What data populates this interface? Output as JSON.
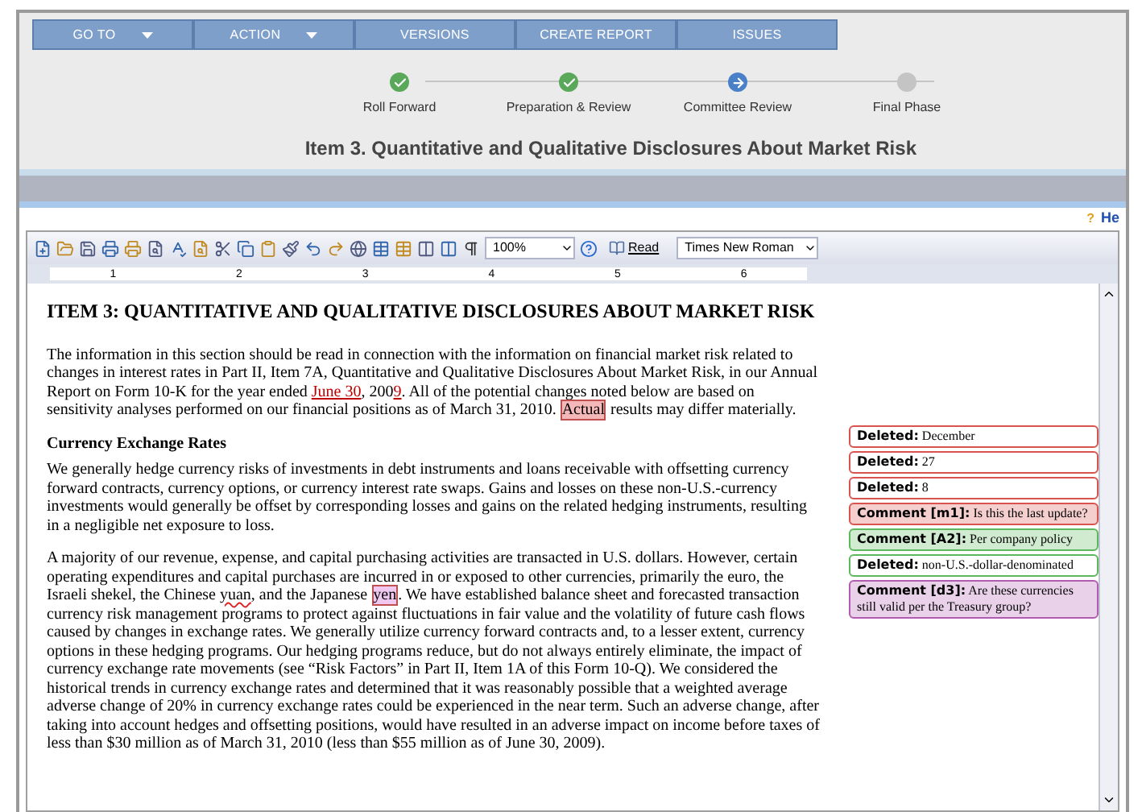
{
  "nav": [
    {
      "label": "GO TO",
      "dropdown": true
    },
    {
      "label": "ACTION",
      "dropdown": true
    },
    {
      "label": "VERSIONS",
      "dropdown": false
    },
    {
      "label": "CREATE REPORT",
      "dropdown": false
    },
    {
      "label": "ISSUES",
      "dropdown": false
    }
  ],
  "steps": [
    {
      "label": "Roll Forward",
      "kind": "done"
    },
    {
      "label": "Preparation & Review",
      "kind": "done"
    },
    {
      "label": "Committee Review",
      "kind": "current"
    },
    {
      "label": "Final Phase",
      "kind": "pending"
    }
  ],
  "page_title": "Item 3. Quantitative and Qualitative Disclosures About Market Risk",
  "help_mark": "?",
  "help_link": "He",
  "toolbar": {
    "zoom": "100%",
    "read": "Read",
    "font": "Times New Roman"
  },
  "ruler": [
    "1",
    "2",
    "3",
    "4",
    "5",
    "6"
  ],
  "document": {
    "heading": "ITEM 3: QUANTITATIVE AND QUALITATIVE DISCLOSURES ABOUT MARKET RISK",
    "blocks": [
      {
        "kind": "paragraph",
        "segments": [
          {
            "kind": "plain",
            "text": "The information in this section should be read in connection with the information on financial market risk related to changes in interest rates in Part II, Item 7A, Quantitative and Qualitative Disclosures About Market Risk, in our Annual Report on Form 10-K for the year ended "
          },
          {
            "kind": "inserted",
            "text": "June 30"
          },
          {
            "kind": "plain",
            "text": ", 200"
          },
          {
            "kind": "inserted",
            "text": "9"
          },
          {
            "kind": "plain",
            "text": ". All of the potential changes noted below are based on sensitivity analyses performed on our financial positions as of March 31, 2010. "
          },
          {
            "kind": "commented",
            "color": "#f4b8b8",
            "text": "Actual"
          },
          {
            "kind": "plain",
            "text": " results may differ materially."
          }
        ]
      },
      {
        "kind": "subheading",
        "segments": [
          {
            "kind": "plain",
            "text": "Currency Exchange Rates"
          }
        ]
      },
      {
        "kind": "paragraph",
        "segments": [
          {
            "kind": "plain",
            "text": "We generally hedge currency risks of investments in debt instruments and loans receivable with offsetting currency forward contracts, currency options, or currency interest rate swaps. Gains and losses on these non-U.S.-currency investments would generally be offset by corresponding losses and gains on the related hedging instruments, resulting in a negligible net exposure to loss."
          }
        ]
      },
      {
        "kind": "paragraph",
        "segments": [
          {
            "kind": "plain",
            "text": "A majority of our revenue, expense, and capital purchasing activities are transacted in U.S. dollars. However, certain operating expenditures and capital purchases are incurred in or exposed to other currencies, primarily the euro, the Israeli shekel, the Chinese "
          },
          {
            "kind": "misspelled",
            "text": "yuan"
          },
          {
            "kind": "plain",
            "text": ", and the Japanese "
          },
          {
            "kind": "commented",
            "color": "#f0c8f0",
            "text": "yen"
          },
          {
            "kind": "plain",
            "text": ". We have established balance sheet and forecasted transaction currency risk management programs to protect against fluctuations in fair value and the volatility of future cash flows caused by changes in exchange rates. We generally utilize currency forward contracts and, to a lesser extent, currency options in these hedging programs. Our hedging programs reduce, but do not always entirely eliminate, the impact of currency exchange rate movements (see “Risk Factors” in Part II, Item 1A of this Form 10-Q). We considered the historical trends in currency exchange rates and determined that it was reasonably possible that a weighted average adverse change of 20% in currency exchange rates could be experienced in the near term. Such an adverse change, after taking into account hedges and offsetting positions, would have resulted in an adverse impact on income before taxes of less than $30 million as of March 31, 2010 (less than $55 million as of June 30, 2009)."
          }
        ]
      }
    ]
  },
  "balloons": [
    {
      "kind": "deleted",
      "label": "Deleted:",
      "text": "December",
      "color": "#d9534f"
    },
    {
      "kind": "deleted",
      "label": "Deleted:",
      "text": "27",
      "color": "#d9534f"
    },
    {
      "kind": "deleted",
      "label": "Deleted:",
      "text": "8",
      "color": "#d9534f"
    },
    {
      "kind": "comment",
      "label": "Comment [m1]:",
      "text": "Is this the last update?",
      "color": "#d9534f"
    },
    {
      "kind": "comment",
      "label": "Comment [A2]:",
      "text": "Per company policy",
      "color": "#5cb85c"
    },
    {
      "kind": "deleted",
      "label": "Deleted:",
      "text": "non-U.S.-dollar-denominated",
      "color": "#5cb85c"
    },
    {
      "kind": "comment",
      "label": "Comment [d3]:",
      "text": "Are these currencies still valid per the Treasury group?",
      "color": "#b05cb0"
    }
  ]
}
